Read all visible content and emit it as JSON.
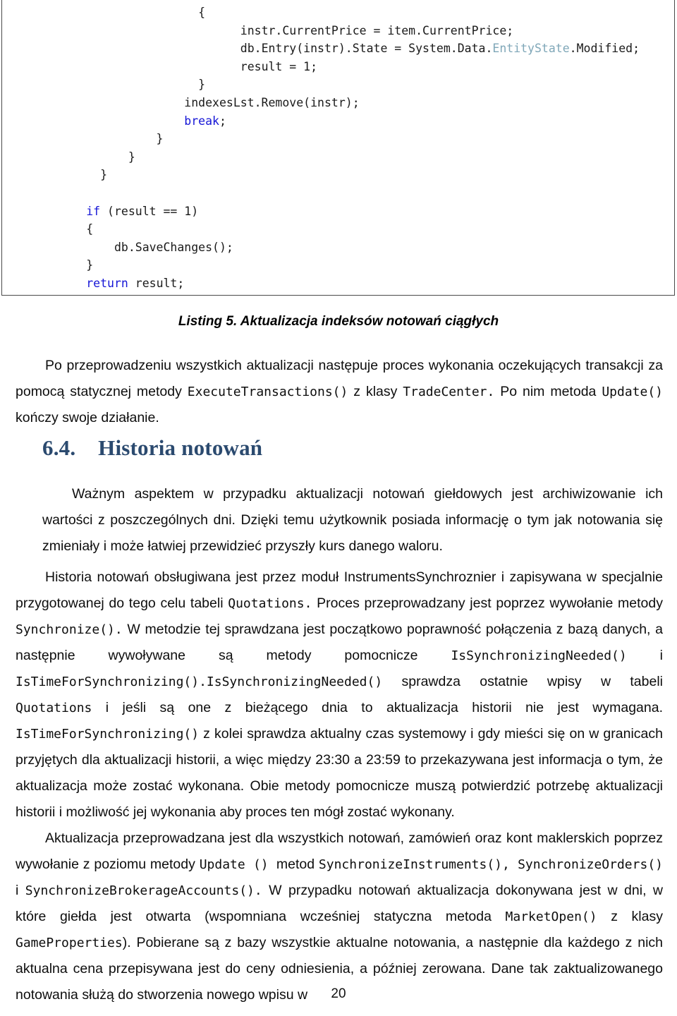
{
  "document": {
    "page_number": "20",
    "language": "pl"
  },
  "code_listing": {
    "caption": "Listing 5. Aktualizacja indeksów notowań ciągłych",
    "lines": [
      {
        "indent": 28,
        "segments": [
          {
            "text": "{",
            "style": "plain"
          }
        ]
      },
      {
        "indent": 34,
        "segments": [
          {
            "text": "instr.CurrentPrice = item.CurrentPrice;",
            "style": "plain"
          }
        ]
      },
      {
        "indent": 34,
        "segments": [
          {
            "text": "db.Entry(instr).State = System.Data.",
            "style": "plain"
          },
          {
            "text": "EntityState",
            "style": "type"
          },
          {
            "text": ".Modified;",
            "style": "plain"
          }
        ]
      },
      {
        "indent": 34,
        "segments": [
          {
            "text": "result = 1;",
            "style": "plain"
          }
        ]
      },
      {
        "indent": 28,
        "segments": [
          {
            "text": "}",
            "style": "plain"
          }
        ]
      },
      {
        "indent": 26,
        "segments": [
          {
            "text": "indexesLst.Remove(instr);",
            "style": "plain"
          }
        ]
      },
      {
        "indent": 26,
        "segments": [
          {
            "text": "break",
            "style": "keyword"
          },
          {
            "text": ";",
            "style": "plain"
          }
        ]
      },
      {
        "indent": 22,
        "segments": [
          {
            "text": "}",
            "style": "plain"
          }
        ]
      },
      {
        "indent": 18,
        "segments": [
          {
            "text": "}",
            "style": "plain"
          }
        ]
      },
      {
        "indent": 14,
        "segments": [
          {
            "text": "}",
            "style": "plain"
          }
        ]
      },
      {
        "indent": 0,
        "segments": [
          {
            "text": "",
            "style": "plain"
          }
        ]
      },
      {
        "indent": 12,
        "segments": [
          {
            "text": "if",
            "style": "keyword"
          },
          {
            "text": " (result == 1)",
            "style": "plain"
          }
        ]
      },
      {
        "indent": 12,
        "segments": [
          {
            "text": "{",
            "style": "plain"
          }
        ]
      },
      {
        "indent": 16,
        "segments": [
          {
            "text": "db.SaveChanges();",
            "style": "plain"
          }
        ]
      },
      {
        "indent": 12,
        "segments": [
          {
            "text": "}",
            "style": "plain"
          }
        ]
      },
      {
        "indent": 12,
        "segments": [
          {
            "text": "return",
            "style": "keyword"
          },
          {
            "text": " result;",
            "style": "plain"
          }
        ]
      },
      {
        "indent": 8,
        "segments": [
          {
            "text": "}",
            "style": "plain"
          }
        ]
      },
      {
        "indent": 4,
        "segments": [
          {
            "text": "}",
            "style": "plain"
          }
        ]
      }
    ],
    "colors": {
      "keyword": "#1515d6",
      "type": "#7fa7b8",
      "text": "#1a1a1a",
      "border": "#4a4a4a"
    }
  },
  "section": {
    "number": "6.4.",
    "title": "Historia notowań",
    "color": "#2b4a6f"
  },
  "paragraphs": {
    "p1": [
      {
        "text": "Po przeprowadzeniu wszystkich aktualizacji następuje proces wykonania oczekujących transakcji za pomocą statycznej metody ",
        "style": "normal"
      },
      {
        "text": "ExecuteTransactions()",
        "style": "mono"
      },
      {
        "text": " z klasy ",
        "style": "normal"
      },
      {
        "text": "TradeCenter.",
        "style": "mono"
      },
      {
        "text": " Po nim metoda ",
        "style": "normal"
      },
      {
        "text": "Update()",
        "style": "mono"
      },
      {
        "text": " kończy swoje działanie.",
        "style": "normal"
      }
    ],
    "p2": [
      {
        "text": "Ważnym aspektem w przypadku aktualizacji notowań giełdowych jest archiwizowanie ich wartości z poszczególnych dni. Dzięki temu użytkownik posiada informację o tym jak notowania się zmieniały i może łatwiej przewidzieć przyszły kurs danego waloru.",
        "style": "normal"
      }
    ],
    "p3": [
      {
        "text": "Historia notowań obsługiwana jest przez moduł InstrumentsSynchroznier  i zapisywana w specjalnie przygotowanej do tego celu tabeli ",
        "style": "normal"
      },
      {
        "text": "Quotations.",
        "style": "mono"
      },
      {
        "text": " Proces przeprowadzany jest poprzez wywołanie metody ",
        "style": "normal"
      },
      {
        "text": "Synchronize().",
        "style": "mono"
      },
      {
        "text": " W metodzie tej sprawdzana jest początkowo poprawność połączenia z bazą danych, a następnie wywoływane są metody pomocnicze ",
        "style": "normal"
      },
      {
        "text": "IsSynchronizingNeeded()",
        "style": "mono"
      },
      {
        "text": " i ",
        "style": "normal"
      },
      {
        "text": "IsTimeForSynchronizing().IsSynchronizingNeeded()",
        "style": "mono"
      },
      {
        "text": " sprawdza ostatnie wpisy w tabeli ",
        "style": "normal"
      },
      {
        "text": "Quotations",
        "style": "mono"
      },
      {
        "text": " i jeśli są one z bieżącego dnia to aktualizacja historii nie jest wymagana. ",
        "style": "normal"
      },
      {
        "text": "IsTimeForSynchronizing()",
        "style": "mono"
      },
      {
        "text": " z kolei sprawdza aktualny czas systemowy i gdy mieści się on w granicach przyjętych dla aktualizacji historii, a więc między 23:30 a 23:59 to przekazywana jest informacja o tym, że aktualizacja może zostać wykonana. Obie metody pomocnicze muszą potwierdzić potrzebę aktualizacji historii i możliwość jej wykonania aby proces ten mógł zostać wykonany.",
        "style": "normal"
      }
    ],
    "p4": [
      {
        "text": "Aktualizacja przeprowadzana jest dla wszystkich notowań, zamówień oraz kont maklerskich poprzez wywołanie z poziomu metody  ",
        "style": "normal"
      },
      {
        "text": "Update () ",
        "style": "mono"
      },
      {
        "text": "metod ",
        "style": "normal"
      },
      {
        "text": "SynchronizeInstruments(), SynchronizeOrders()",
        "style": "mono"
      },
      {
        "text": " i ",
        "style": "normal"
      },
      {
        "text": "SynchronizeBrokerageAccounts().",
        "style": "mono"
      },
      {
        "text": " W przypadku notowań aktualizacja dokonywana jest w dni, w które giełda jest otwarta (wspomniana wcześniej statyczna metoda ",
        "style": "normal"
      },
      {
        "text": "MarketOpen()",
        "style": "mono"
      },
      {
        "text": " z klasy ",
        "style": "normal"
      },
      {
        "text": "GameProperties",
        "style": "mono"
      },
      {
        "text": "). Pobierane są z bazy wszystkie aktualne notowania, a następnie dla każdego z nich aktualna cena przepisywana jest do ceny odniesienia, a później zerowana. Dane tak zaktualizowanego notowania służą do stworzenia  nowego wpisu w",
        "style": "normal"
      }
    ]
  }
}
